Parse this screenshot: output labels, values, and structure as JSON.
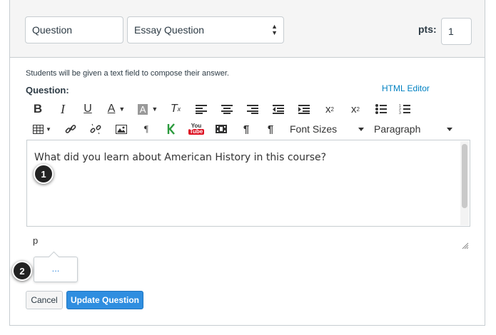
{
  "question": {
    "name_value": "Question",
    "type_value": "Essay Question",
    "pts_label": "pts:",
    "pts_value": "1",
    "note": "Students will be given a text field to compose their answer.",
    "label": "Question:",
    "html_editor_link": "HTML Editor"
  },
  "toolbar": {
    "row1": [
      "bold-icon",
      "italic-icon",
      "underline-icon",
      "text-color-icon",
      "background-color-icon",
      "clear-formatting-icon",
      "align-left-icon",
      "align-center-icon",
      "align-right-icon",
      "outdent-icon",
      "indent-icon",
      "superscript-icon",
      "subscript-icon",
      "bullet-list-icon",
      "numbered-list-icon"
    ],
    "row2": [
      "table-icon",
      "link-icon",
      "unlink-icon",
      "image-icon",
      "equation-icon",
      "kaltura-icon",
      "youtube-icon",
      "media-icon",
      "ltr-icon",
      "rtl-icon"
    ],
    "font_sizes_label": "Font Sizes",
    "paragraph_label": "Paragraph",
    "youtube_top": "You",
    "youtube_bottom": "Tube"
  },
  "editor": {
    "content": "What did you learn about American History in this course?",
    "path": "p",
    "more_label": "..."
  },
  "callouts": {
    "one": "1",
    "two": "2"
  },
  "buttons": {
    "cancel": "Cancel",
    "update": "Update Question"
  },
  "colors": {
    "accent": "#2f8ee0",
    "link": "#0081c2",
    "callout": "#222222"
  }
}
